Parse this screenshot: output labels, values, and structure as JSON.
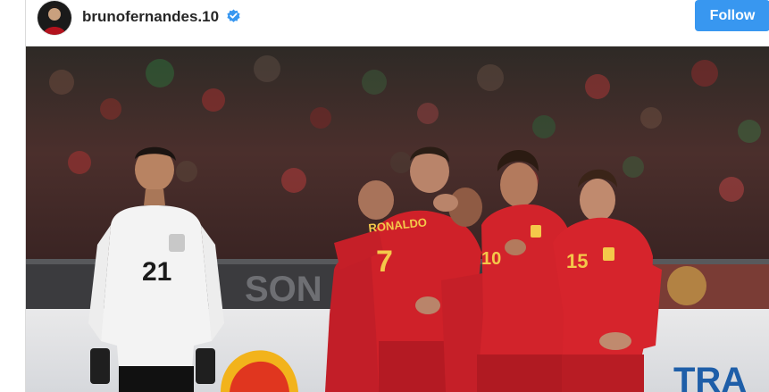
{
  "post": {
    "username": "brunofernandes.10",
    "verified_icon": "verified-badge-icon",
    "follow_label": "Follow",
    "accent_color": "#3897f0"
  },
  "photo": {
    "jersey_number_white": "21",
    "jersey_name_red": "RONALDO",
    "jersey_number_red_left": "7",
    "jersey_number_red_mid": "10",
    "jersey_number_red_right": "15",
    "ad_board_text": "TRA"
  }
}
